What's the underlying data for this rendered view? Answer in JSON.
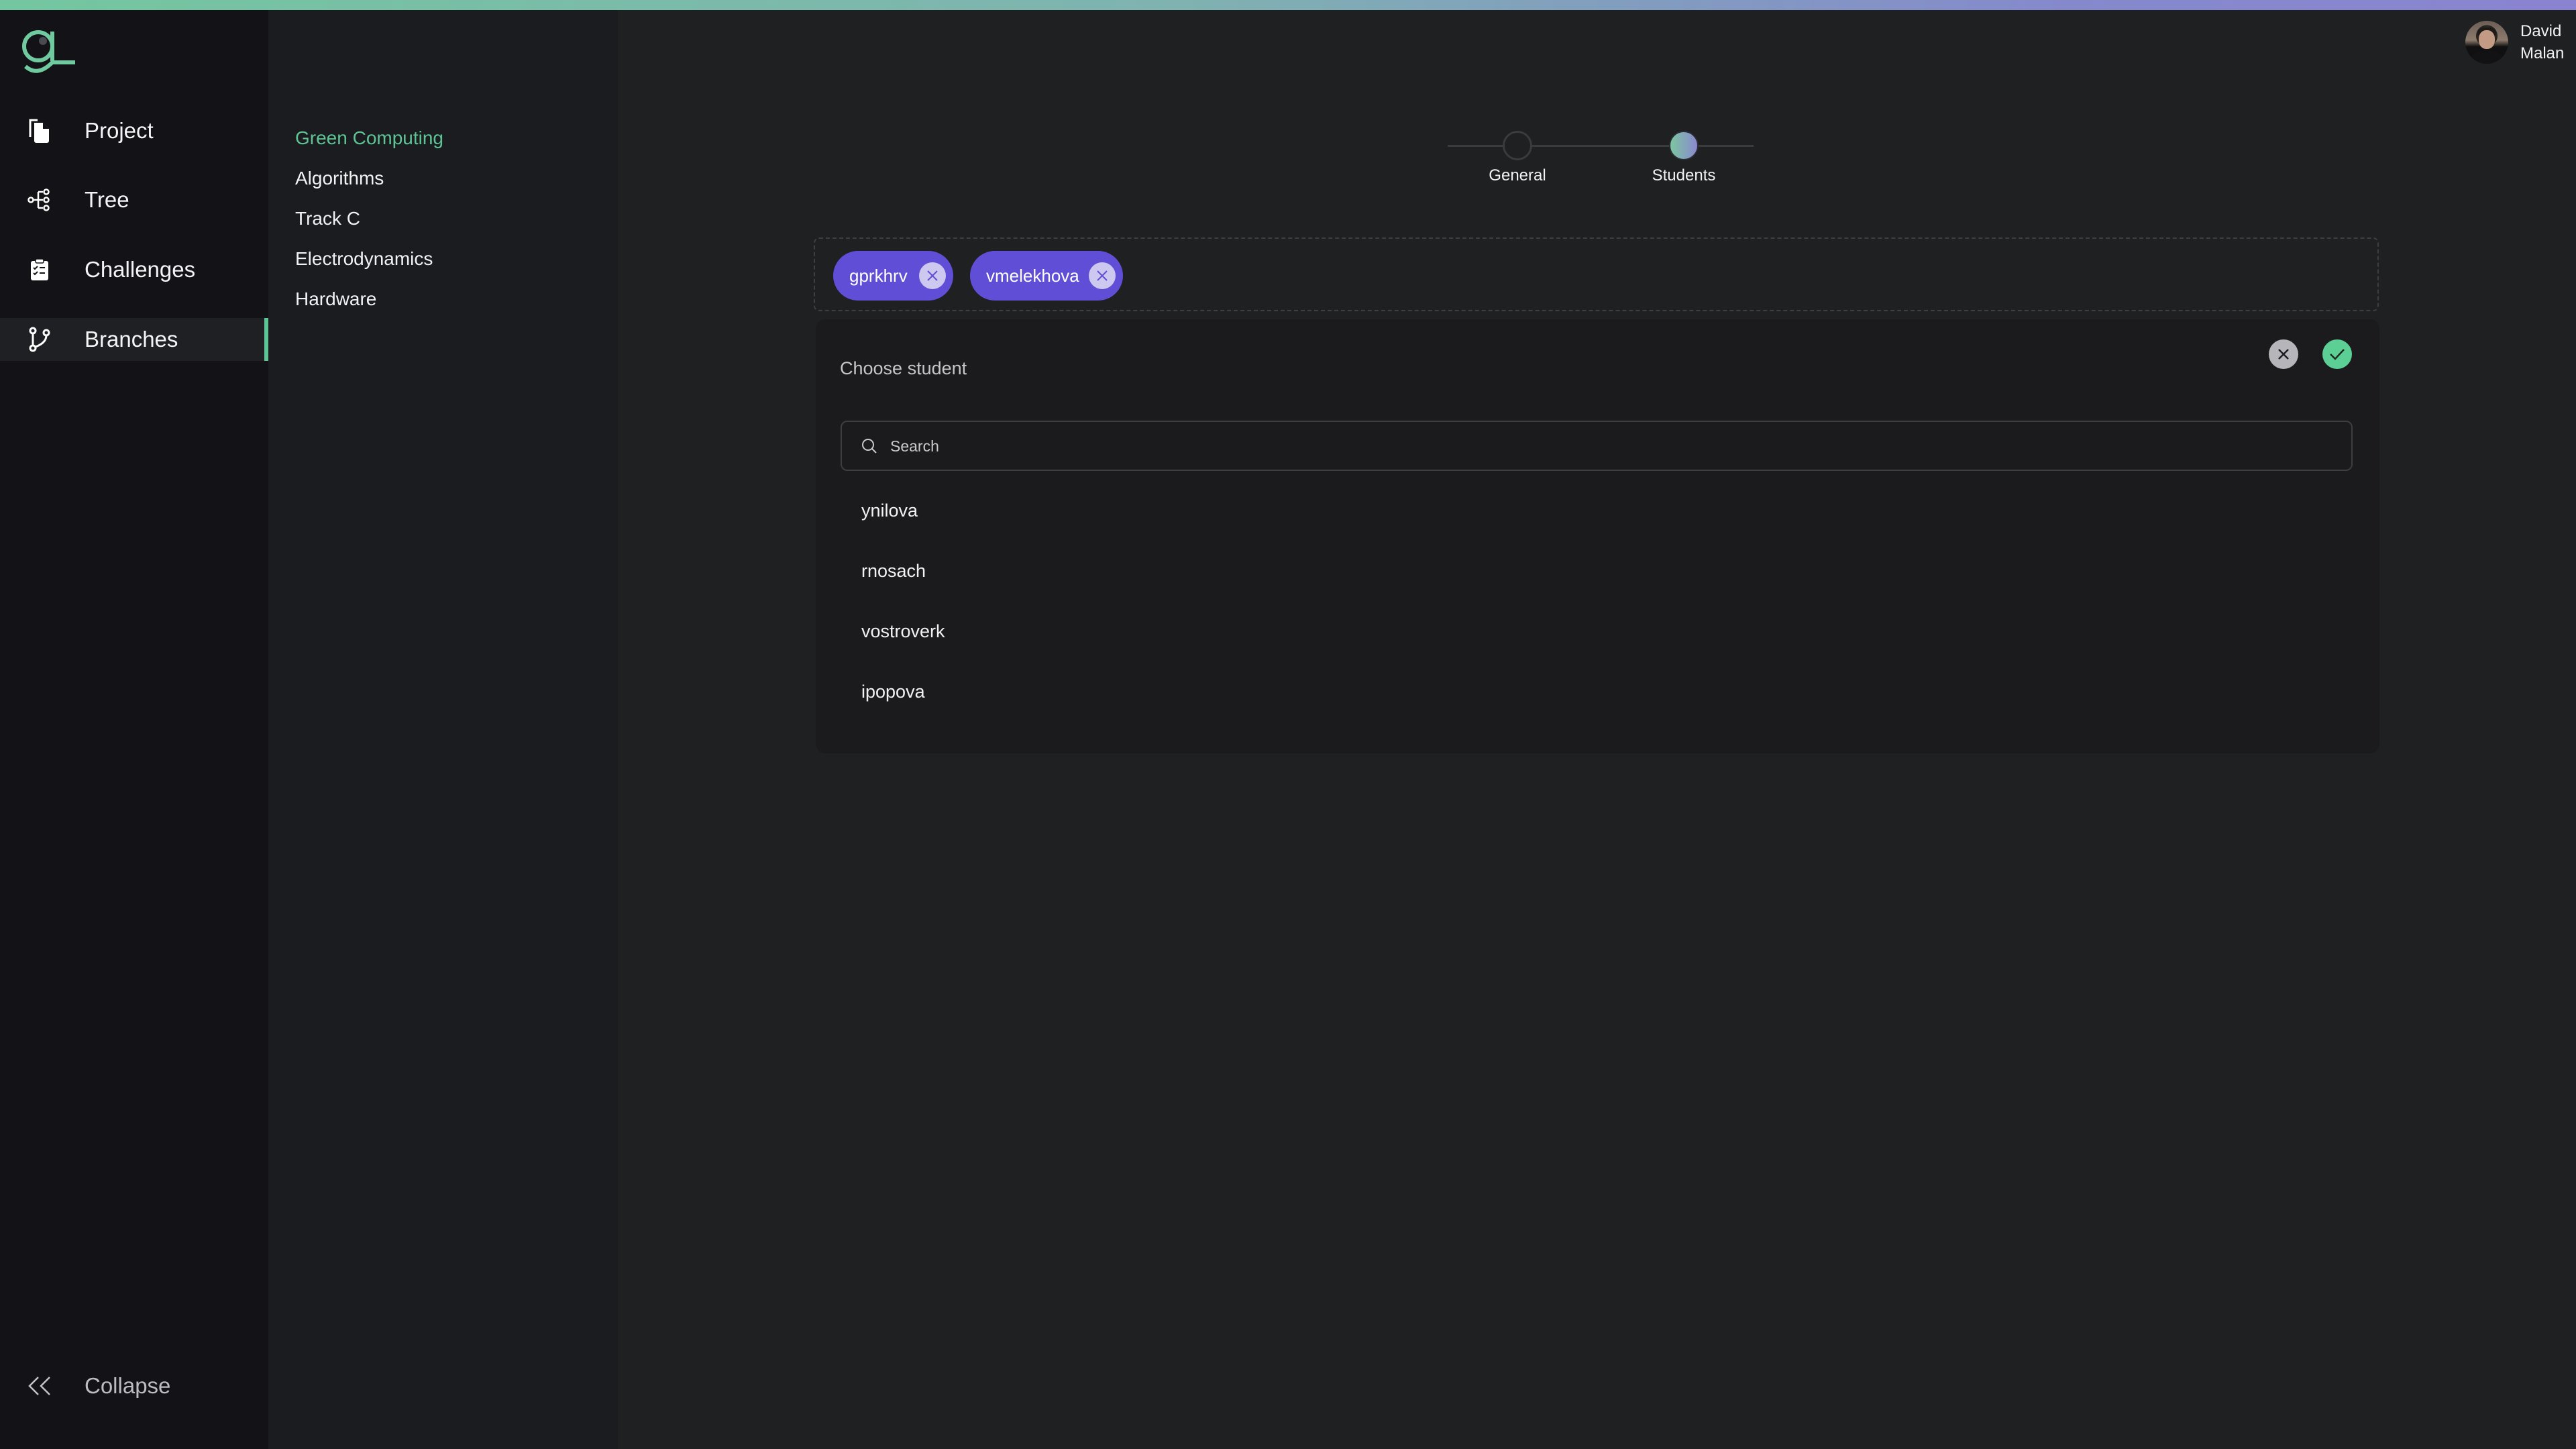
{
  "brand": {
    "logo": "g-logo",
    "accent": "#5ec495",
    "chip_color": "#604fd6"
  },
  "sidebar": {
    "items": [
      {
        "label": "Project",
        "icon": "document-copy-icon",
        "active": false
      },
      {
        "label": "Tree",
        "icon": "tree-icon",
        "active": false
      },
      {
        "label": "Challenges",
        "icon": "clipboard-checklist-icon",
        "active": false
      },
      {
        "label": "Branches",
        "icon": "git-branch-icon",
        "active": true
      }
    ],
    "collapse_label": "Collapse"
  },
  "subnav": {
    "items": [
      {
        "label": "Green Computing",
        "active": true
      },
      {
        "label": "Algorithms",
        "active": false
      },
      {
        "label": "Track C",
        "active": false
      },
      {
        "label": "Electrodynamics",
        "active": false
      },
      {
        "label": "Hardware",
        "active": false
      }
    ]
  },
  "user": {
    "first_name": "David",
    "last_name": "Malan"
  },
  "stepper": {
    "steps": [
      {
        "label": "General",
        "state": "incomplete"
      },
      {
        "label": "Students",
        "state": "current"
      }
    ]
  },
  "selected_students": [
    {
      "label": "gprkhrv"
    },
    {
      "label": "vmelekhova"
    }
  ],
  "chooser": {
    "title": "Choose student",
    "search": {
      "placeholder": "Search",
      "value": ""
    },
    "options": [
      {
        "label": "ynilova"
      },
      {
        "label": "rnosach"
      },
      {
        "label": "vostroverk"
      },
      {
        "label": "ipopova"
      }
    ]
  }
}
